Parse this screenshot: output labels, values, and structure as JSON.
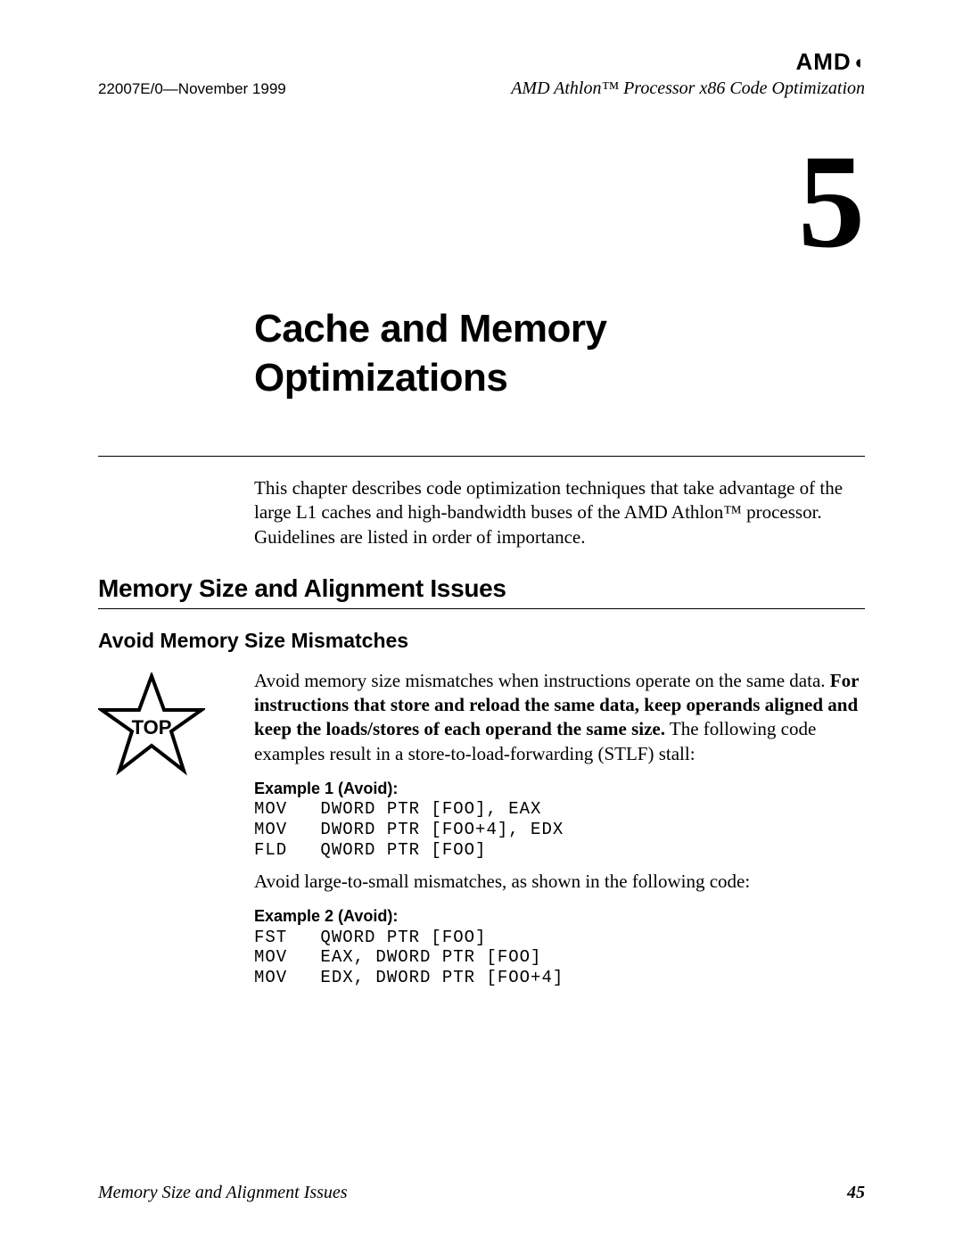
{
  "logo": "AMD",
  "header": {
    "doc_id": "22007E/0—November 1999",
    "doc_title": "AMD Athlon™ Processor x86 Code Optimization"
  },
  "chapter": {
    "number": "5",
    "title_line1": "Cache and Memory",
    "title_line2": "Optimizations"
  },
  "intro": "This chapter describes code optimization techniques that take advantage of the large L1 caches and high-bandwidth buses of the AMD Athlon™ processor. Guidelines are listed in order of importance.",
  "section1": {
    "title": "Memory Size and Alignment Issues",
    "sub1": {
      "title": "Avoid Memory Size Mismatches",
      "star_label": "TOP",
      "para1_a": "Avoid memory size mismatches when instructions operate on the same data. ",
      "para1_b_bold": "For instructions that store and reload the same data, keep operands aligned and keep the loads/stores of each operand the same size.",
      "para1_c": " The following code examples result in a store-to-load-forwarding (STLF) stall:",
      "example1_label": "Example 1 (Avoid):",
      "example1_code": "MOV   DWORD PTR [FOO], EAX\nMOV   DWORD PTR [FOO+4], EDX\nFLD   QWORD PTR [FOO]",
      "para2": "Avoid large-to-small mismatches, as shown in the following code:",
      "example2_label": "Example 2 (Avoid):",
      "example2_code": "FST   QWORD PTR [FOO]\nMOV   EAX, DWORD PTR [FOO]\nMOV   EDX, DWORD PTR [FOO+4]"
    }
  },
  "footer": {
    "left": "Memory Size and Alignment Issues",
    "page": "45"
  }
}
